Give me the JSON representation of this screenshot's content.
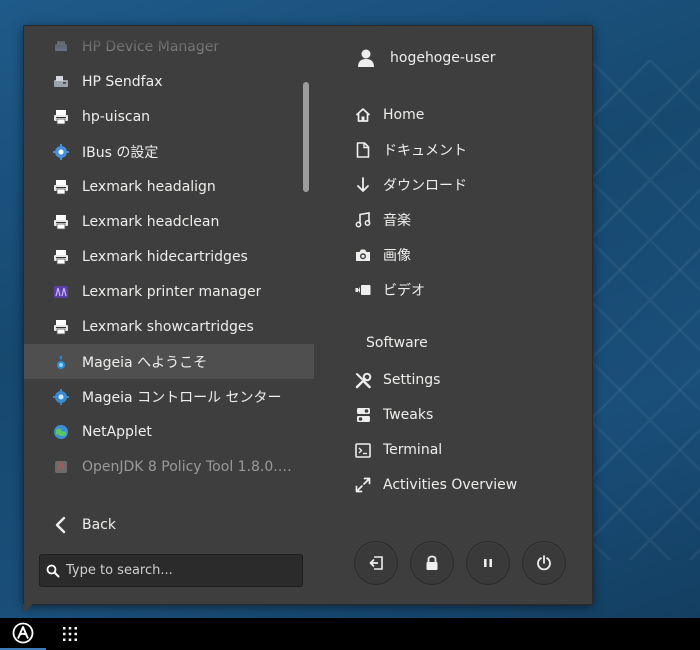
{
  "apps_list": [
    {
      "label": "HP Device Manager",
      "icon": "hp-device-manager-icon",
      "dim": true
    },
    {
      "label": "HP Sendfax",
      "icon": "fax-icon"
    },
    {
      "label": "hp-uiscan",
      "icon": "printer-icon"
    },
    {
      "label": "IBus の設定",
      "icon": "ibus-gear-icon"
    },
    {
      "label": "Lexmark headalign",
      "icon": "printer-icon"
    },
    {
      "label": "Lexmark headclean",
      "icon": "printer-icon"
    },
    {
      "label": "Lexmark hidecartridges",
      "icon": "printer-icon"
    },
    {
      "label": "Lexmark printer manager",
      "icon": "lexmark-manager-icon"
    },
    {
      "label": "Lexmark showcartridges",
      "icon": "printer-icon"
    },
    {
      "label": "Mageia へようこそ",
      "icon": "mageia-icon",
      "highlighted": true
    },
    {
      "label": "Mageia コントロール センター",
      "icon": "control-center-gear-icon"
    },
    {
      "label": "NetApplet",
      "icon": "netapplet-globe-icon"
    },
    {
      "label": "OpenJDK 8 Policy Tool 1.8.0.…",
      "icon": "java-policy-icon",
      "dim": true
    }
  ],
  "back_label": "Back",
  "search": {
    "placeholder": "Type to search..."
  },
  "user": {
    "name": "hogehoge-user"
  },
  "places": [
    {
      "label": "Home",
      "icon": "home-icon"
    },
    {
      "label": "ドキュメント",
      "icon": "document-icon"
    },
    {
      "label": "ダウンロード",
      "icon": "download-icon"
    },
    {
      "label": "音楽",
      "icon": "music-icon"
    },
    {
      "label": "画像",
      "icon": "camera-icon"
    },
    {
      "label": "ビデオ",
      "icon": "video-icon"
    }
  ],
  "software_label": "Software",
  "software": [
    {
      "label": "Settings",
      "icon": "settings-tools-icon"
    },
    {
      "label": "Tweaks",
      "icon": "tweaks-icon"
    },
    {
      "label": "Terminal",
      "icon": "terminal-icon"
    },
    {
      "label": "Activities Overview",
      "icon": "activities-expand-icon"
    }
  ],
  "session_buttons": [
    {
      "name": "logout-button",
      "icon": "logout-icon"
    },
    {
      "name": "lock-button",
      "icon": "lock-icon"
    },
    {
      "name": "suspend-button",
      "icon": "pause-icon"
    },
    {
      "name": "power-button",
      "icon": "power-icon"
    }
  ],
  "colors": {
    "menu_bg": "#3e3e3e",
    "highlight": "#4f4f4f",
    "accent": "#3d7ab8"
  }
}
